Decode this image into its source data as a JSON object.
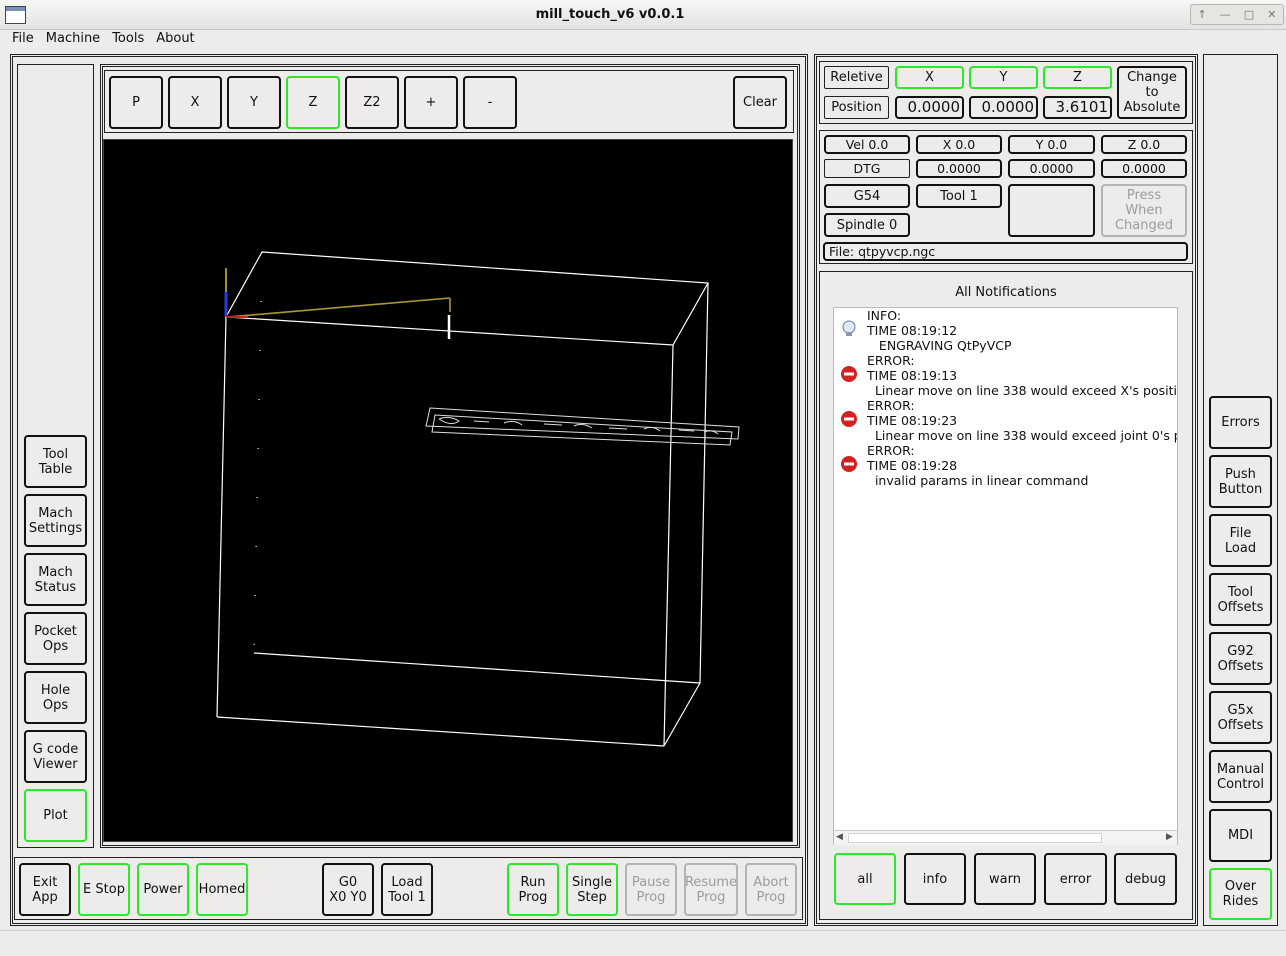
{
  "window": {
    "title": "mill_touch_v6 v0.0.1"
  },
  "menu": [
    "File",
    "Machine",
    "Tools",
    "About"
  ],
  "plot_toolbar": {
    "p": "P",
    "x": "X",
    "y": "Y",
    "z": "Z",
    "z2": "Z2",
    "zoom_in": "+",
    "zoom_out": "-",
    "clear": "Clear"
  },
  "left_nav": {
    "tool_table": "Tool\nTable",
    "mach_settings": "Mach\nSettings",
    "mach_status": "Mach\nStatus",
    "pocket_ops": "Pocket\nOps",
    "hole_ops": "Hole\nOps",
    "gcode_viewer": "G code\nViewer",
    "plot": "Plot"
  },
  "bottom_bar": {
    "exit_app": "Exit\nApp",
    "estop": "E Stop",
    "power": "Power",
    "homed": "Homed",
    "g0": "G0\nX0 Y0",
    "load_tool": "Load\nTool 1",
    "run_prog": "Run\nProg",
    "single_step": "Single\nStep",
    "pause_prog": "Pause\nProg",
    "resume_prog": "Resume\nProg",
    "abort_prog": "Abort\nProg"
  },
  "dro": {
    "relative": "Reletive",
    "position": "Position",
    "x_label": "X",
    "y_label": "Y",
    "z_label": "Z",
    "x_value": "0.0000",
    "y_value": "0.0000",
    "z_value": "3.6101",
    "change_to_absolute": "Change to\nAbsolute"
  },
  "status": {
    "vel": "Vel 0.0",
    "x": "X 0.0",
    "y": "Y 0.0",
    "z": "Z 0.0",
    "dtg": "DTG",
    "dtg_x": "0.0000",
    "dtg_y": "0.0000",
    "dtg_z": "0.0000",
    "g54": "G54",
    "tool": "Tool 1",
    "spindle": "Spindle 0",
    "press_when_changed": "Press\nWhen\nChanged",
    "file": "File: qtpyvcp.ngc"
  },
  "notifications": {
    "title": "All Notifications",
    "lines": [
      "INFO:",
      "TIME 08:19:12",
      "   ENGRAVING QtPyVCP",
      "ERROR:",
      "TIME 08:19:13",
      "  Linear move on line 338 would exceed X's positi",
      "ERROR:",
      "TIME 08:19:23",
      "  Linear move on line 338 would exceed joint 0's p",
      "ERROR:",
      "TIME 08:19:28",
      "  invalid params in linear command"
    ],
    "filters": {
      "all": "all",
      "info": "info",
      "warn": "warn",
      "error": "error",
      "debug": "debug"
    }
  },
  "right_nav": {
    "errors": "Errors",
    "push_button": "Push\nButton",
    "file_load": "File\nLoad",
    "tool_offsets": "Tool\nOffsets",
    "g92_offsets": "G92\nOffsets",
    "g5x_offsets": "G5x\nOffsets",
    "manual_control": "Manual\nControl",
    "mdi": "MDI",
    "overrides": "Over\nRides"
  },
  "colors": {
    "active_border": "#2be82b",
    "disabled_text": "#9d9c99",
    "plot_bg": "#000000"
  }
}
